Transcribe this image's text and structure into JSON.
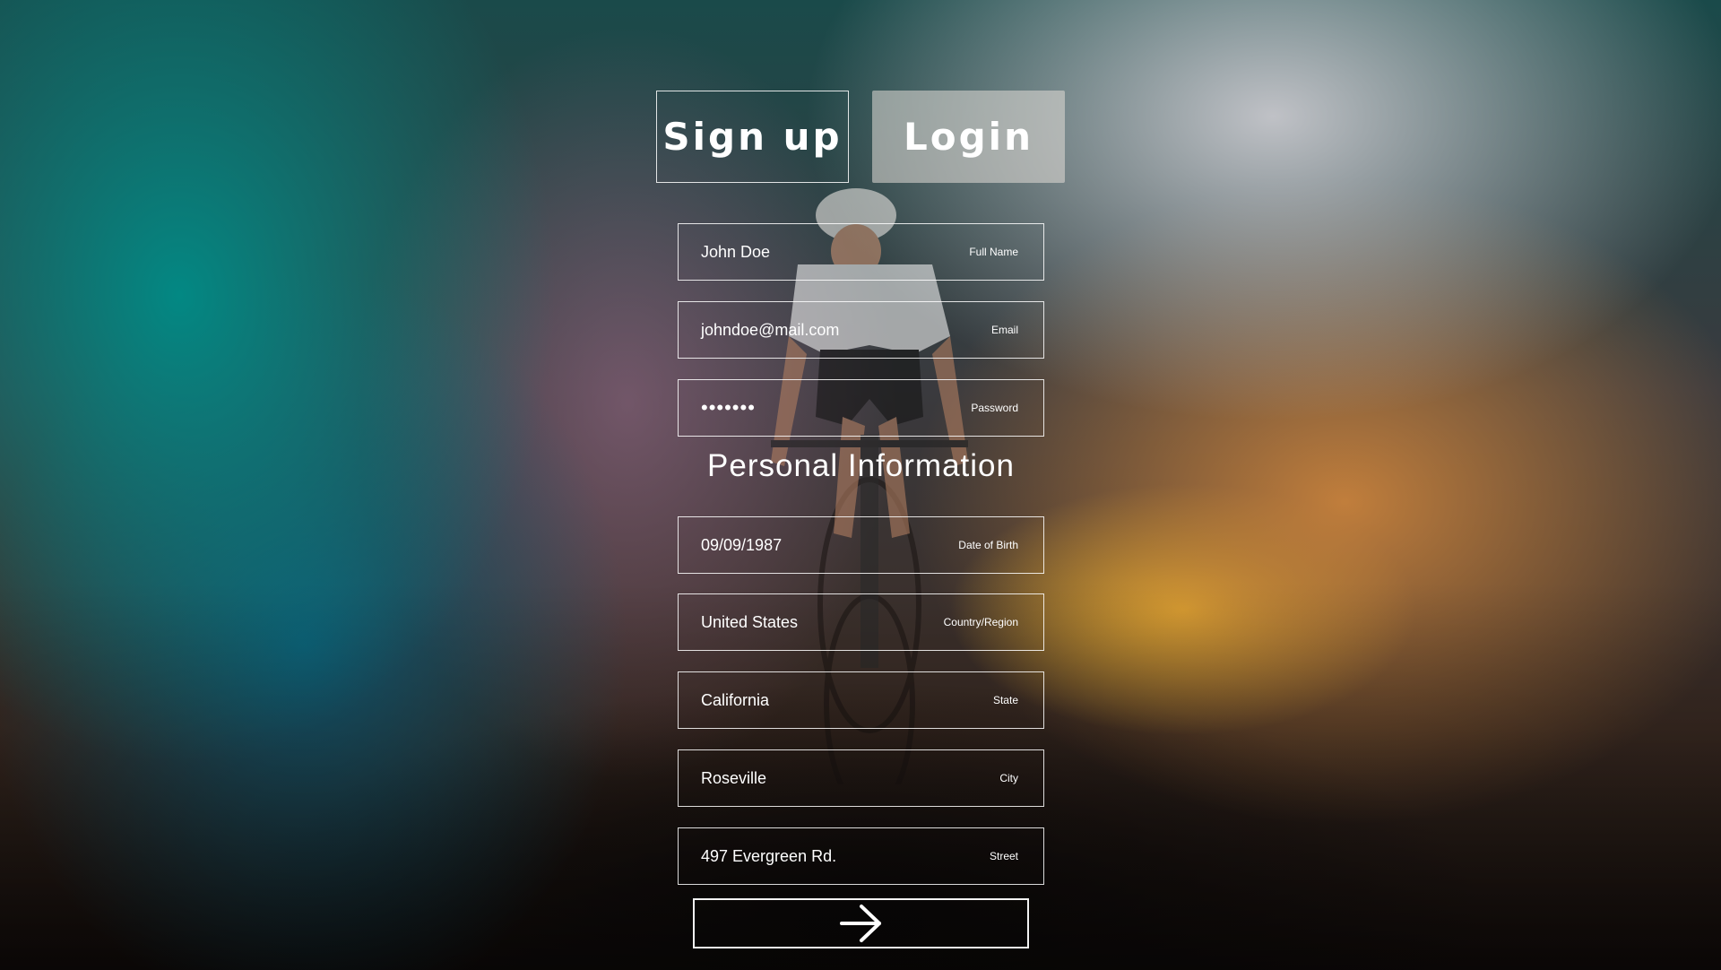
{
  "tabs": {
    "signup_label": "Sign up",
    "login_label": "Login"
  },
  "account": {
    "full_name": {
      "value": "John Doe",
      "label": "Full Name"
    },
    "email": {
      "value": "johndoe@mail.com",
      "label": "Email"
    },
    "password": {
      "value": "•••••••",
      "label": "Password"
    }
  },
  "personal": {
    "title": "Personal Information",
    "date_of_birth": {
      "value": "09/09/1987",
      "label": "Date of Birth"
    },
    "country": {
      "value": "United States",
      "label": "Country/Region"
    },
    "state": {
      "value": "California",
      "label": "State"
    },
    "city": {
      "value": "Roseville",
      "label": "City"
    },
    "street": {
      "value": "497 Evergreen Rd.",
      "label": "Street"
    }
  },
  "submit": {
    "icon": "arrow-right-icon"
  },
  "background": {
    "subject": "cyclist-photo"
  }
}
